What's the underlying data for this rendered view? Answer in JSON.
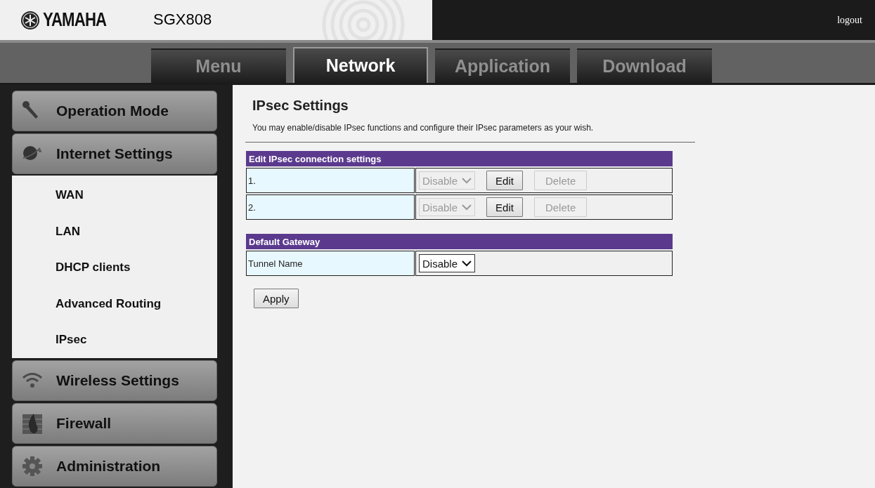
{
  "header": {
    "brand": "YAMAHA",
    "model": "SGX808",
    "logout": "logout"
  },
  "tabs": [
    {
      "label": "Menu",
      "selected": false
    },
    {
      "label": "Network",
      "selected": true
    },
    {
      "label": "Application",
      "selected": false
    },
    {
      "label": "Download",
      "selected": false
    }
  ],
  "sidebar": {
    "items": [
      {
        "label": "Operation Mode"
      },
      {
        "label": "Internet Settings",
        "children": [
          {
            "label": "WAN"
          },
          {
            "label": "LAN"
          },
          {
            "label": "DHCP clients"
          },
          {
            "label": "Advanced Routing"
          },
          {
            "label": "IPsec"
          }
        ]
      },
      {
        "label": "Wireless Settings"
      },
      {
        "label": "Firewall"
      },
      {
        "label": "Administration"
      }
    ]
  },
  "content": {
    "title": "IPsec Settings",
    "description": "You may enable/disable IPsec functions and configure their IPsec parameters as your wish.",
    "sections": [
      {
        "title": "Edit IPsec connection settings",
        "rows": [
          {
            "label": "1.",
            "select": {
              "value": "Disable",
              "disabled": true
            },
            "buttons": [
              {
                "label": "Edit",
                "disabled": false
              },
              {
                "label": "Delete",
                "disabled": true
              }
            ]
          },
          {
            "label": "2.",
            "select": {
              "value": "Disable",
              "disabled": true
            },
            "buttons": [
              {
                "label": "Edit",
                "disabled": false
              },
              {
                "label": "Delete",
                "disabled": true
              }
            ]
          }
        ]
      },
      {
        "title": "Default Gateway",
        "rows": [
          {
            "label": "Tunnel Name",
            "select": {
              "value": "Disable",
              "disabled": false
            }
          }
        ]
      }
    ],
    "apply": "Apply"
  }
}
